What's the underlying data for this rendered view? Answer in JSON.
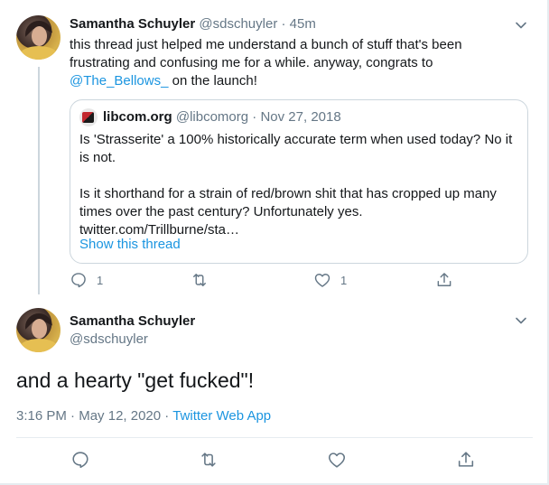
{
  "colors": {
    "accent": "#1b95e0",
    "text": "#14171a",
    "muted": "#657786",
    "border": "#ccd6dd"
  },
  "tweet1": {
    "display_name": "Samantha Schuyler",
    "handle": "@sdschuyler",
    "separator": "·",
    "time": "45m",
    "text_before": "this thread just helped me understand a bunch of stuff that's been frustrating and confusing me for a while. anyway, congrats to",
    "mention": "@The_Bellows_",
    "text_after": " on the launch!",
    "quote": {
      "display_name": "libcom.org",
      "handle": "@libcomorg",
      "separator": "·",
      "date": "Nov 27, 2018",
      "paragraph1": "Is 'Strasserite' a 100% historically accurate term when used today? No it is not.",
      "paragraph2": "Is it shorthand for a strain of red/brown shit that has cropped up many times over the past century? Unfortunately yes.",
      "paragraph3": "twitter.com/Trillburne/sta…",
      "show_thread": "Show this thread"
    },
    "actions": {
      "reply_count": "1",
      "retweet_count": "",
      "like_count": "1"
    }
  },
  "tweet2": {
    "display_name": "Samantha Schuyler",
    "handle": "@sdschuyler",
    "text": "and a hearty \"get fucked\"!",
    "time": "3:16 PM",
    "separator1": "·",
    "date": "May 12, 2020",
    "separator2": "·",
    "app": "Twitter Web App"
  },
  "icons": [
    "chevron-down-icon",
    "reply-icon",
    "retweet-icon",
    "like-icon",
    "share-icon",
    "avatar"
  ]
}
